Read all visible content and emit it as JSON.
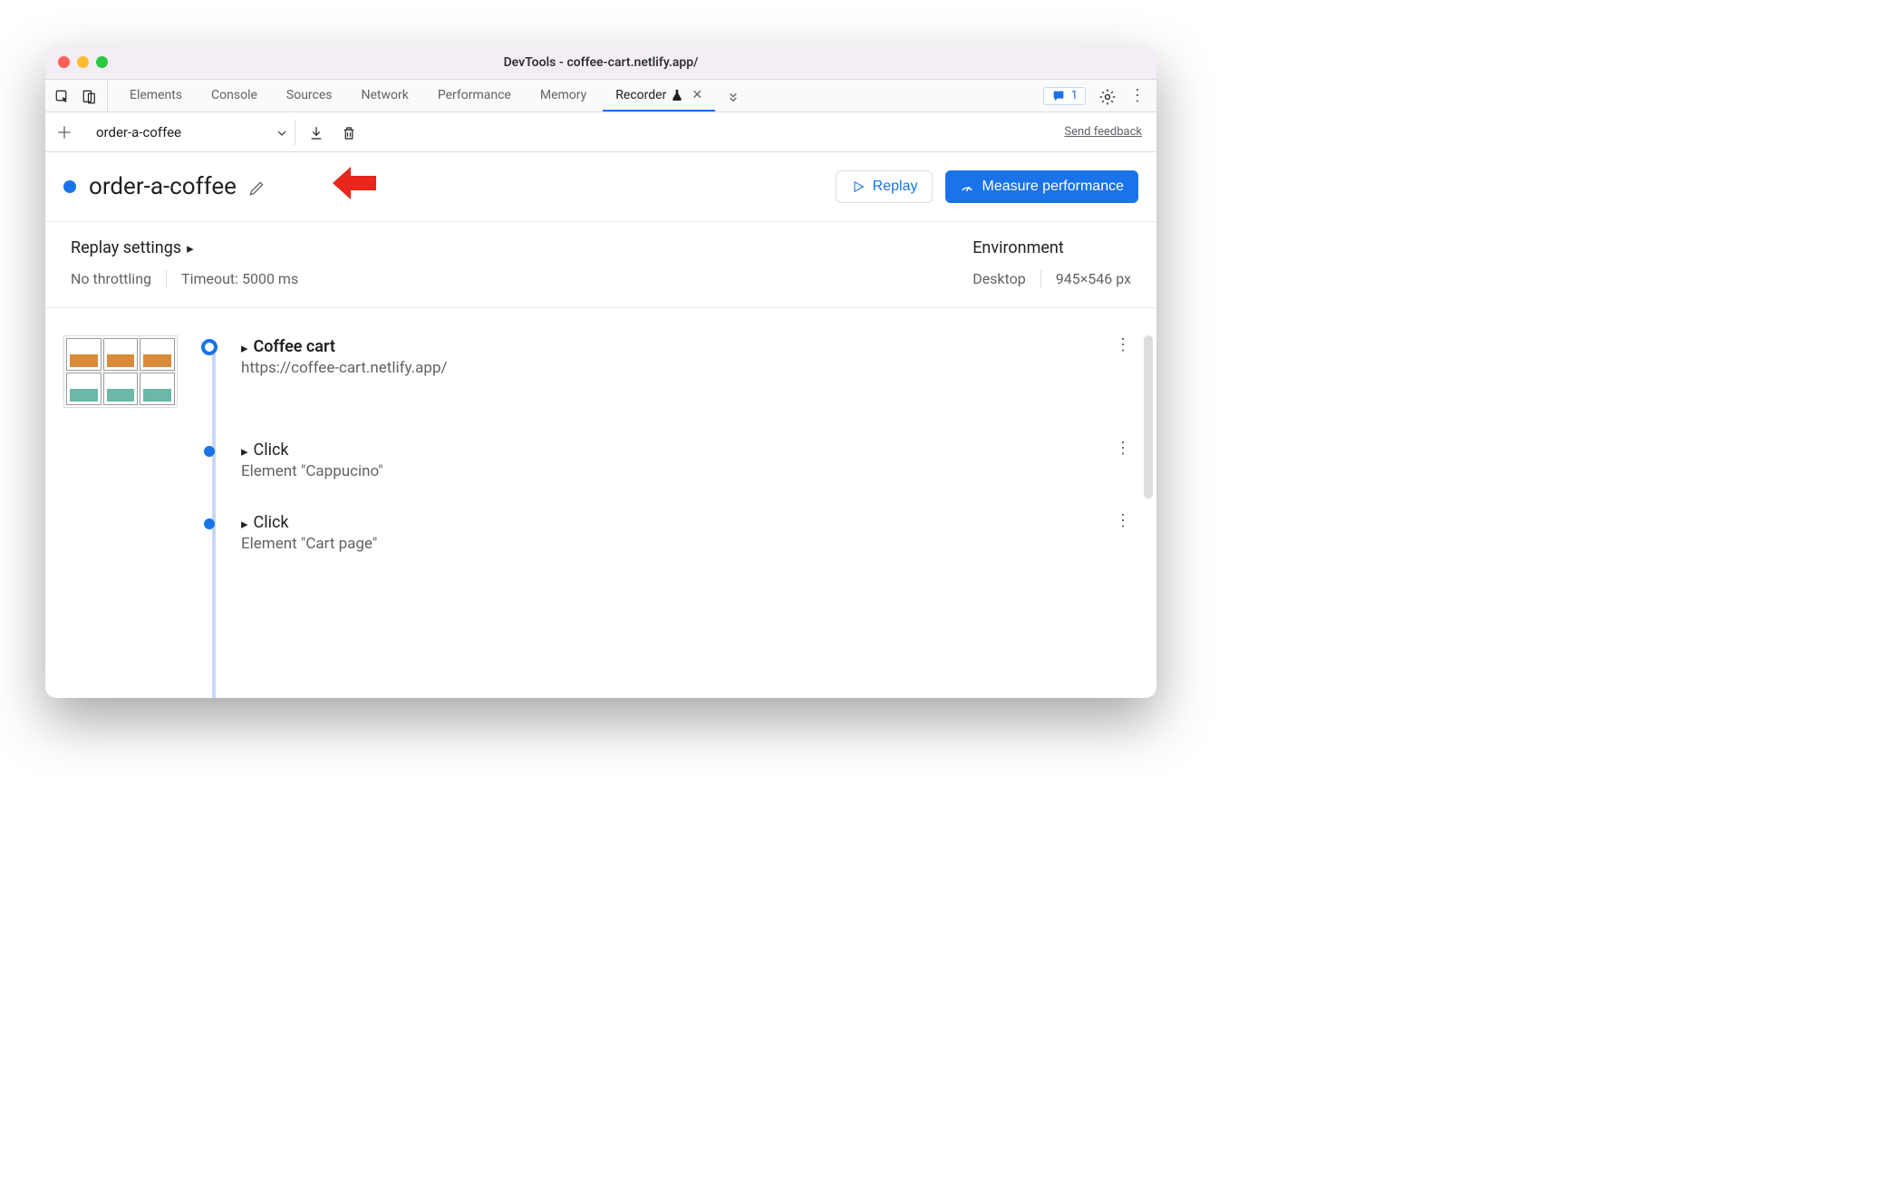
{
  "window": {
    "title": "DevTools - coffee-cart.netlify.app/"
  },
  "tabs": {
    "items": [
      "Elements",
      "Console",
      "Sources",
      "Network",
      "Performance",
      "Memory",
      "Recorder"
    ],
    "active": "Recorder",
    "issues_count": "1"
  },
  "toolbar": {
    "dropdown_value": "order-a-coffee",
    "send_feedback": "Send feedback"
  },
  "recording": {
    "name": "order-a-coffee",
    "replay_label": "Replay",
    "measure_label": "Measure performance"
  },
  "settings": {
    "replay_header": "Replay settings",
    "throttling": "No throttling",
    "timeout": "Timeout: 5000 ms",
    "environment_header": "Environment",
    "device": "Desktop",
    "viewport": "945×546 px"
  },
  "steps": [
    {
      "title": "Coffee cart",
      "subtitle": "https://coffee-cart.netlify.app/",
      "bold": true,
      "large_node": true,
      "thumb": true
    },
    {
      "title": "Click",
      "subtitle": "Element \"Cappucino\"",
      "bold": false,
      "large_node": false,
      "thumb": false
    },
    {
      "title": "Click",
      "subtitle": "Element \"Cart page\"",
      "bold": false,
      "large_node": false,
      "thumb": false
    }
  ],
  "colors": {
    "accent": "#1a73e8"
  }
}
